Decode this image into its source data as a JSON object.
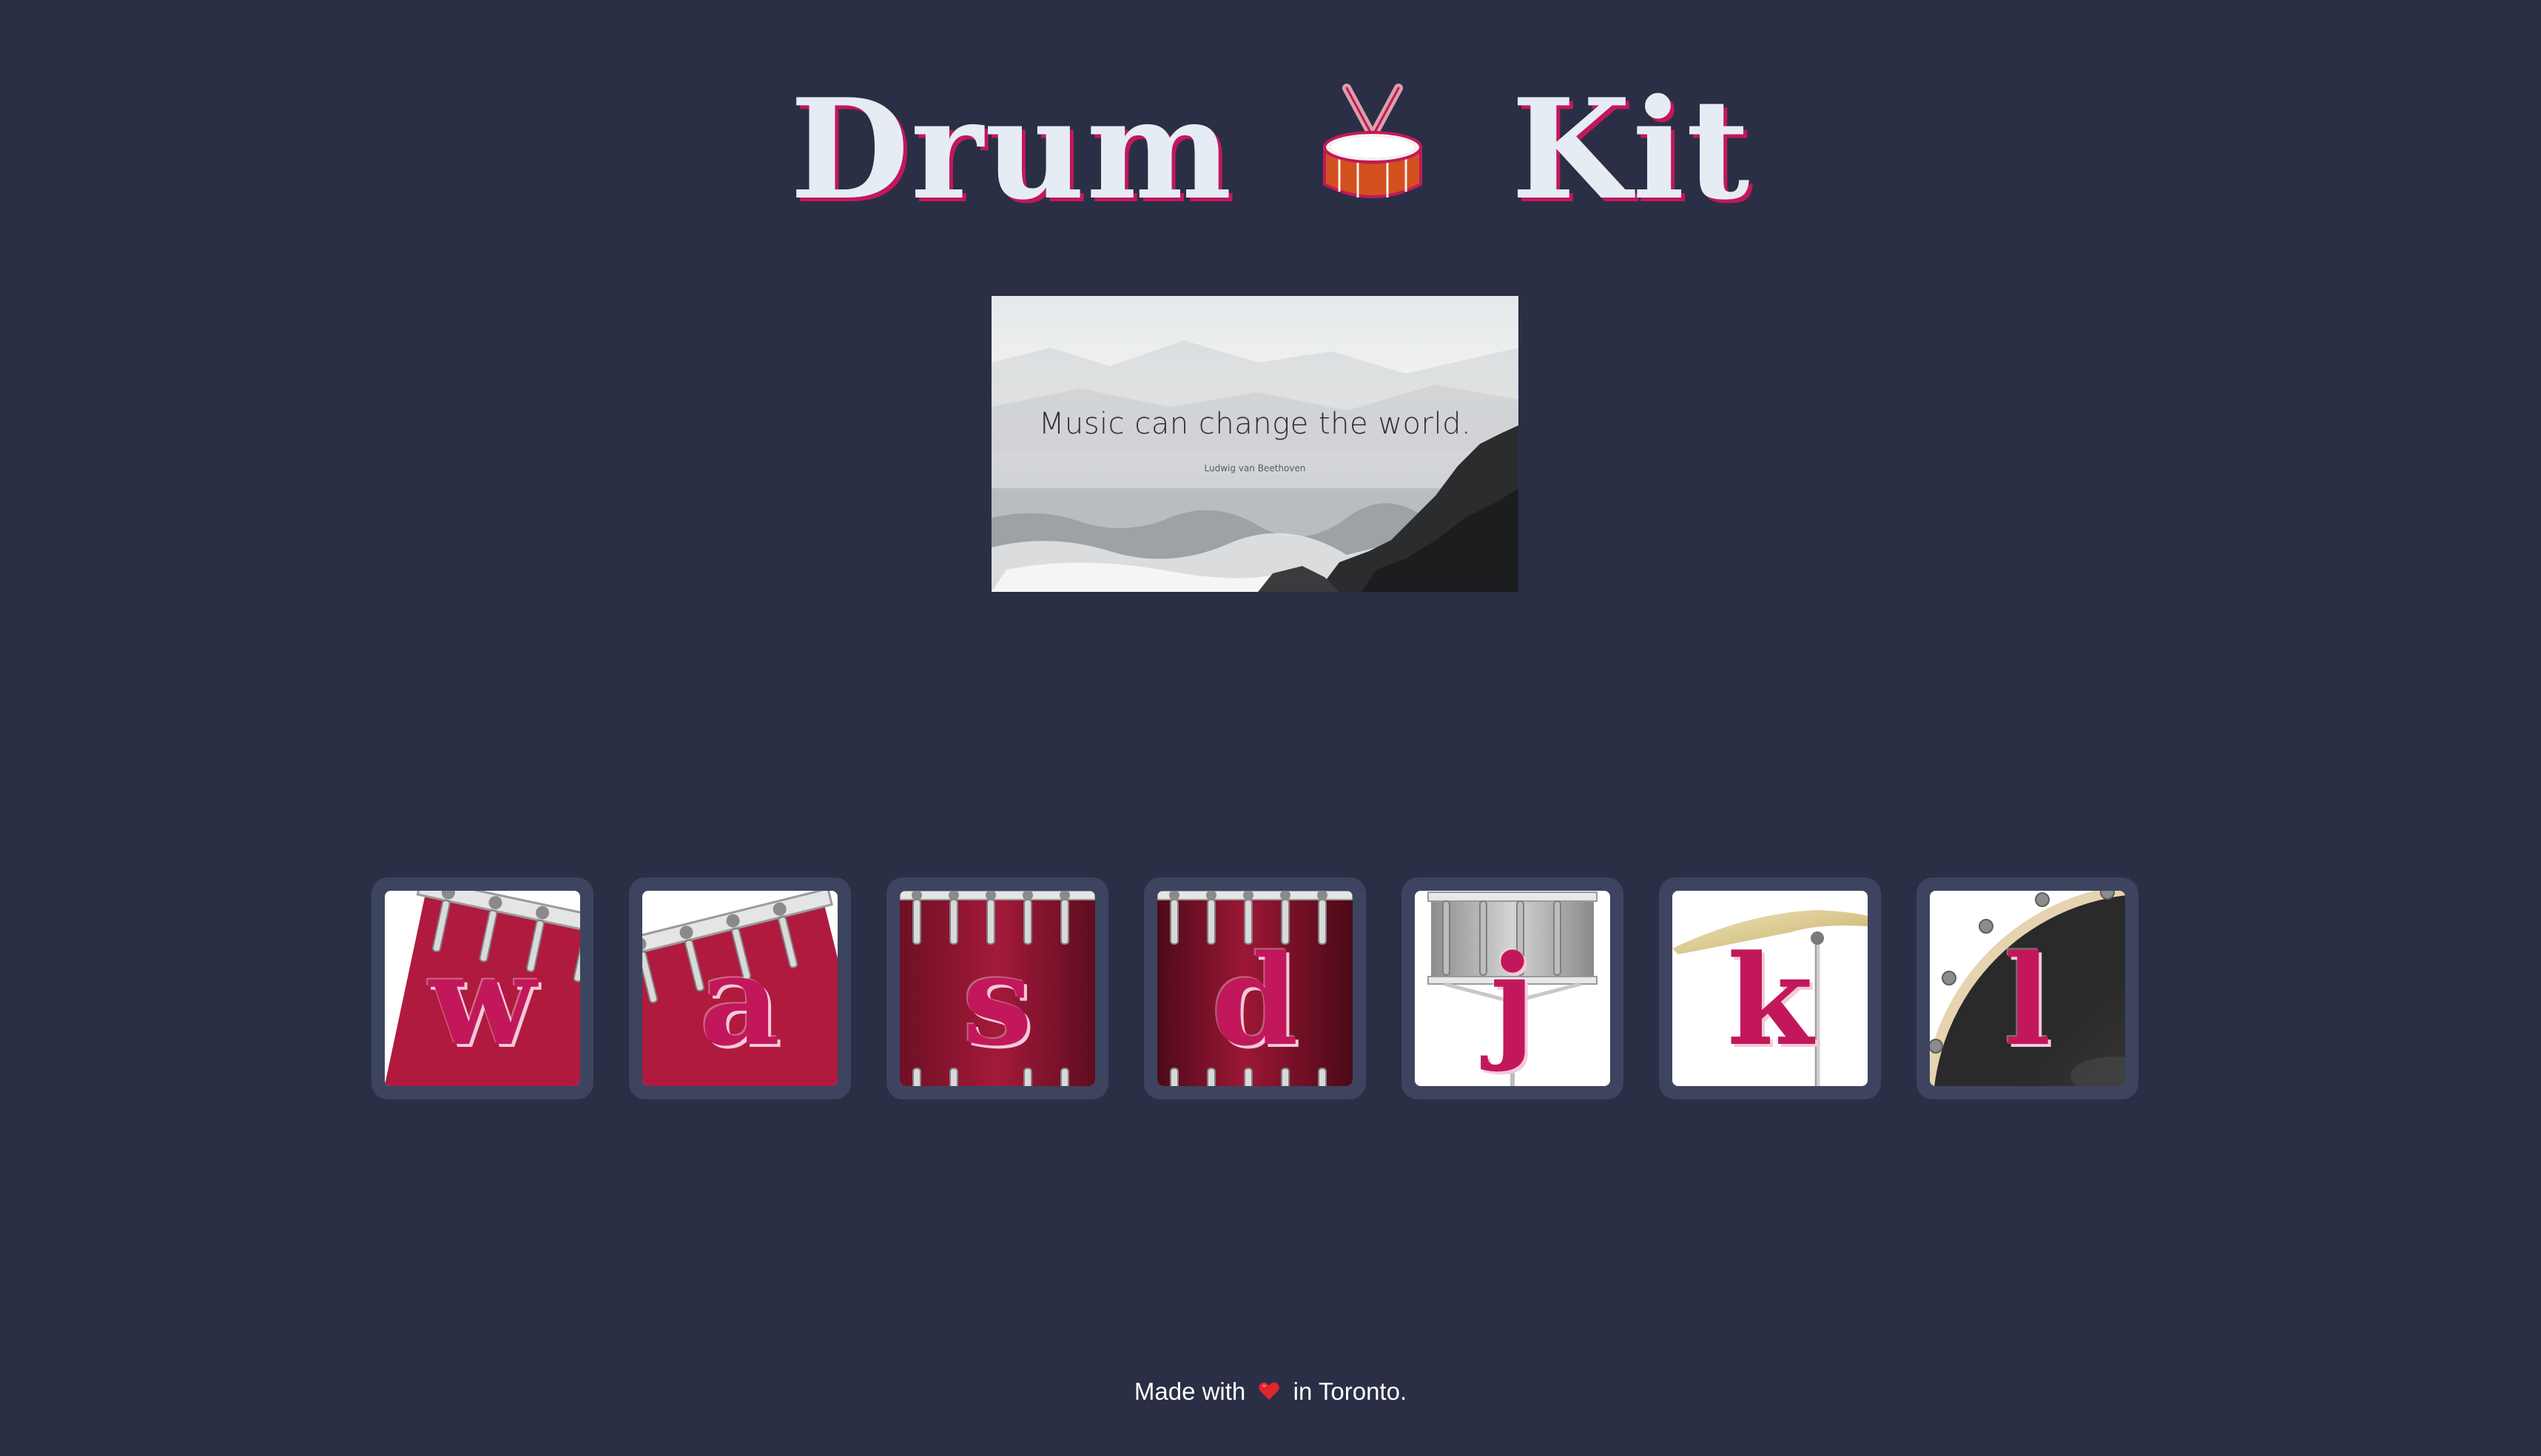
{
  "header": {
    "title_left": "Drum",
    "title_right": "Kit",
    "icon": "drum-emoji"
  },
  "quote": {
    "text": "Music can change the world.",
    "author": "Ludwig van Beethoven"
  },
  "keys": [
    {
      "letter": "w",
      "instrument": "tom-1"
    },
    {
      "letter": "a",
      "instrument": "tom-2"
    },
    {
      "letter": "s",
      "instrument": "tom-3"
    },
    {
      "letter": "d",
      "instrument": "tom-4"
    },
    {
      "letter": "j",
      "instrument": "snare"
    },
    {
      "letter": "k",
      "instrument": "crash"
    },
    {
      "letter": "l",
      "instrument": "kick-bass"
    }
  ],
  "footer": {
    "before": "Made with",
    "icon": "heart-emoji",
    "after": "in Toronto."
  },
  "colors": {
    "background": "#2a2f45",
    "accent": "#c2185b",
    "key_frame": "#3c4460",
    "title_text": "#e6ecf4"
  }
}
